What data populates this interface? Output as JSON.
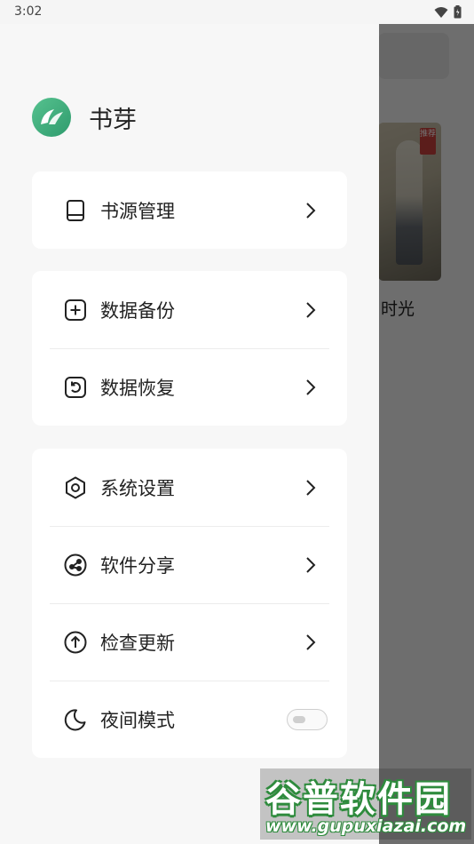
{
  "status_bar": {
    "time": "3:02",
    "icons": [
      "wifi-icon",
      "battery-icon"
    ]
  },
  "background": {
    "book_badge": "推荐",
    "book_title_fragment": "时光"
  },
  "drawer": {
    "app_name": "书芽",
    "groups": [
      {
        "items": [
          {
            "label": "书源管理",
            "icon": "book-icon",
            "trailing": "chevron"
          }
        ]
      },
      {
        "items": [
          {
            "label": "数据备份",
            "icon": "plus-square-icon",
            "trailing": "chevron"
          },
          {
            "label": "数据恢复",
            "icon": "restore-icon",
            "trailing": "chevron"
          }
        ]
      },
      {
        "items": [
          {
            "label": "系统设置",
            "icon": "gear-icon",
            "trailing": "chevron"
          },
          {
            "label": "软件分享",
            "icon": "share-icon",
            "trailing": "chevron"
          },
          {
            "label": "检查更新",
            "icon": "upload-circle-icon",
            "trailing": "chevron"
          },
          {
            "label": "夜间模式",
            "icon": "moon-icon",
            "trailing": "toggle",
            "toggle_on": false
          }
        ]
      }
    ]
  },
  "watermark": {
    "text": "谷普软件园",
    "url": "www.gupuxiazai.com"
  },
  "colors": {
    "accent": "#3aa877",
    "overlay": "#000000",
    "card": "#ffffff",
    "drawer_bg": "#f7f7f7"
  }
}
